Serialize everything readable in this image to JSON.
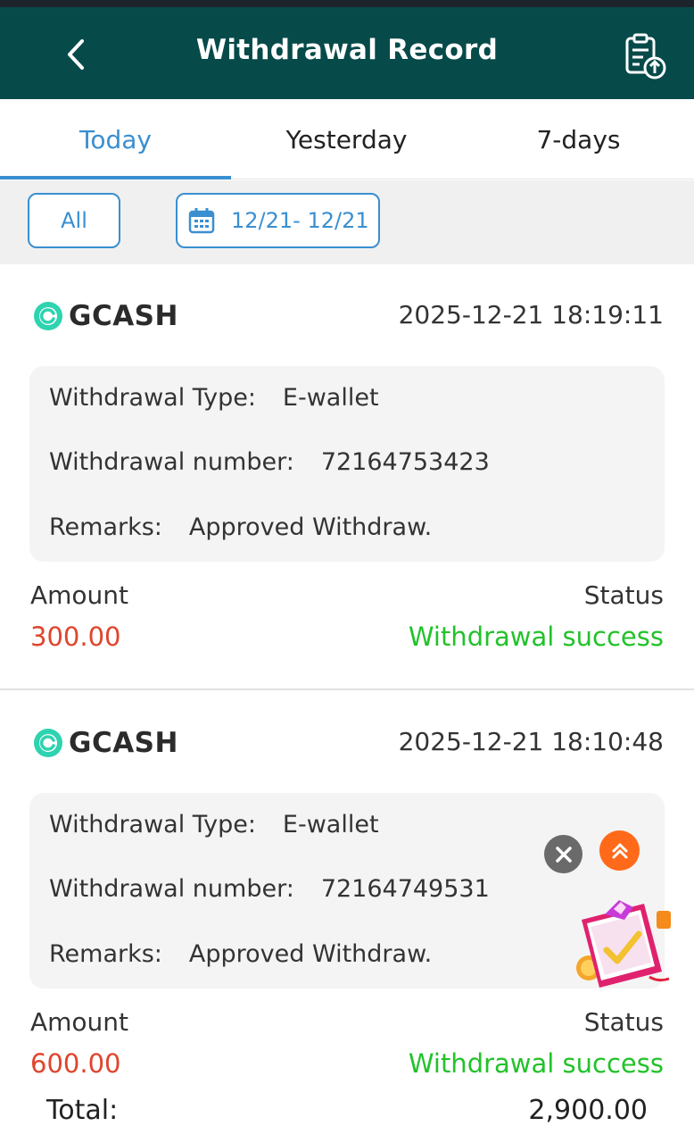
{
  "header": {
    "title": "Withdrawal Record"
  },
  "tabs": [
    {
      "label": "Today",
      "active": true
    },
    {
      "label": "Yesterday",
      "active": false
    },
    {
      "label": "7-days",
      "active": false
    }
  ],
  "filters": {
    "type_label": "All",
    "date_range": "12/21- 12/21"
  },
  "records": [
    {
      "brand": "GCASH",
      "datetime": "2025-12-21 18:19:11",
      "type_label": "Withdrawal Type:",
      "type_value": "E-wallet",
      "number_label": "Withdrawal number:",
      "number_value": "72164753423",
      "remarks_label": "Remarks:",
      "remarks_value": "Approved Withdraw.",
      "amount_label": "Amount",
      "amount_value": "300.00",
      "status_label": "Status",
      "status_value": "Withdrawal success"
    },
    {
      "brand": "GCASH",
      "datetime": "2025-12-21 18:10:48",
      "type_label": "Withdrawal Type:",
      "type_value": "E-wallet",
      "number_label": "Withdrawal number:",
      "number_value": "72164749531",
      "remarks_label": "Remarks:",
      "remarks_value": "Approved Withdraw.",
      "amount_label": "Amount",
      "amount_value": "600.00",
      "status_label": "Status",
      "status_value": "Withdrawal success"
    }
  ],
  "total": {
    "label": "Total:",
    "value": "2,900.00"
  },
  "colors": {
    "header_bg": "#074a4a",
    "accent": "#3a8fd0",
    "amount": "#e0442c",
    "status_success": "#22c22a"
  },
  "icons": {
    "back": "chevron-left-icon",
    "header_action": "clipboard-upload-icon",
    "calendar": "calendar-icon",
    "brand_logo": "gcash-logo-icon",
    "close": "close-icon",
    "scroll_up": "double-chevron-up-icon",
    "promo": "gift-box-icon"
  }
}
